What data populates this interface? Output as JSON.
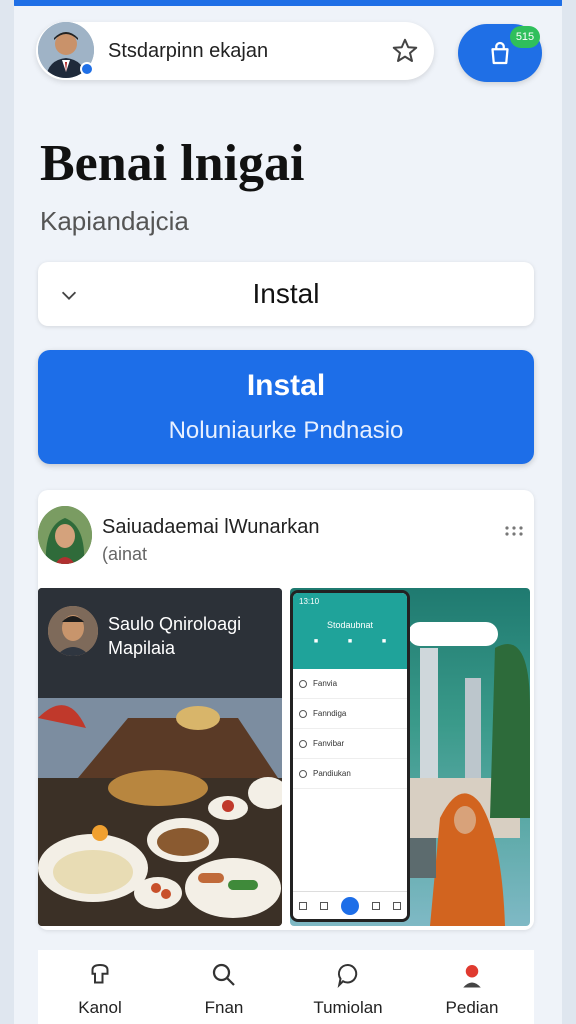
{
  "header": {
    "search_text": "Stsdarpinn ekajan",
    "star_icon": "star-icon",
    "cart_icon": "shopping-bag-icon",
    "cart_badge": "515"
  },
  "page": {
    "title": "Benai lnigai",
    "subtitle": "Kapiandajcia"
  },
  "buttons": {
    "install_outline_label": "Instal",
    "install_primary_label": "Instal",
    "install_primary_sublabel": "Noluniaurke Pndnasio"
  },
  "post": {
    "author": "Saiuadaemai lWunarkan",
    "meta": "(ainat",
    "preview_left": {
      "title_line1": "Saulo Qniroloagi",
      "title_line2": "Mapilaia"
    },
    "preview_right": {
      "time": "13:10",
      "app_title": "Stodaubnat",
      "tabs": [
        "",
        "",
        ""
      ],
      "rows": [
        "Fanvia",
        "Fanndiga",
        "Fanvibar",
        "Pandiukan"
      ]
    }
  },
  "bottom_nav": [
    {
      "label": "Kanol",
      "icon": "home-icon"
    },
    {
      "label": "Fnan",
      "icon": "search-icon"
    },
    {
      "label": "Tumiolan",
      "icon": "chat-icon"
    },
    {
      "label": "Pedian",
      "icon": "profile-icon"
    }
  ],
  "colors": {
    "primary": "#1d6ee8",
    "badge": "#2fbf5b",
    "background": "#eff3f9"
  }
}
